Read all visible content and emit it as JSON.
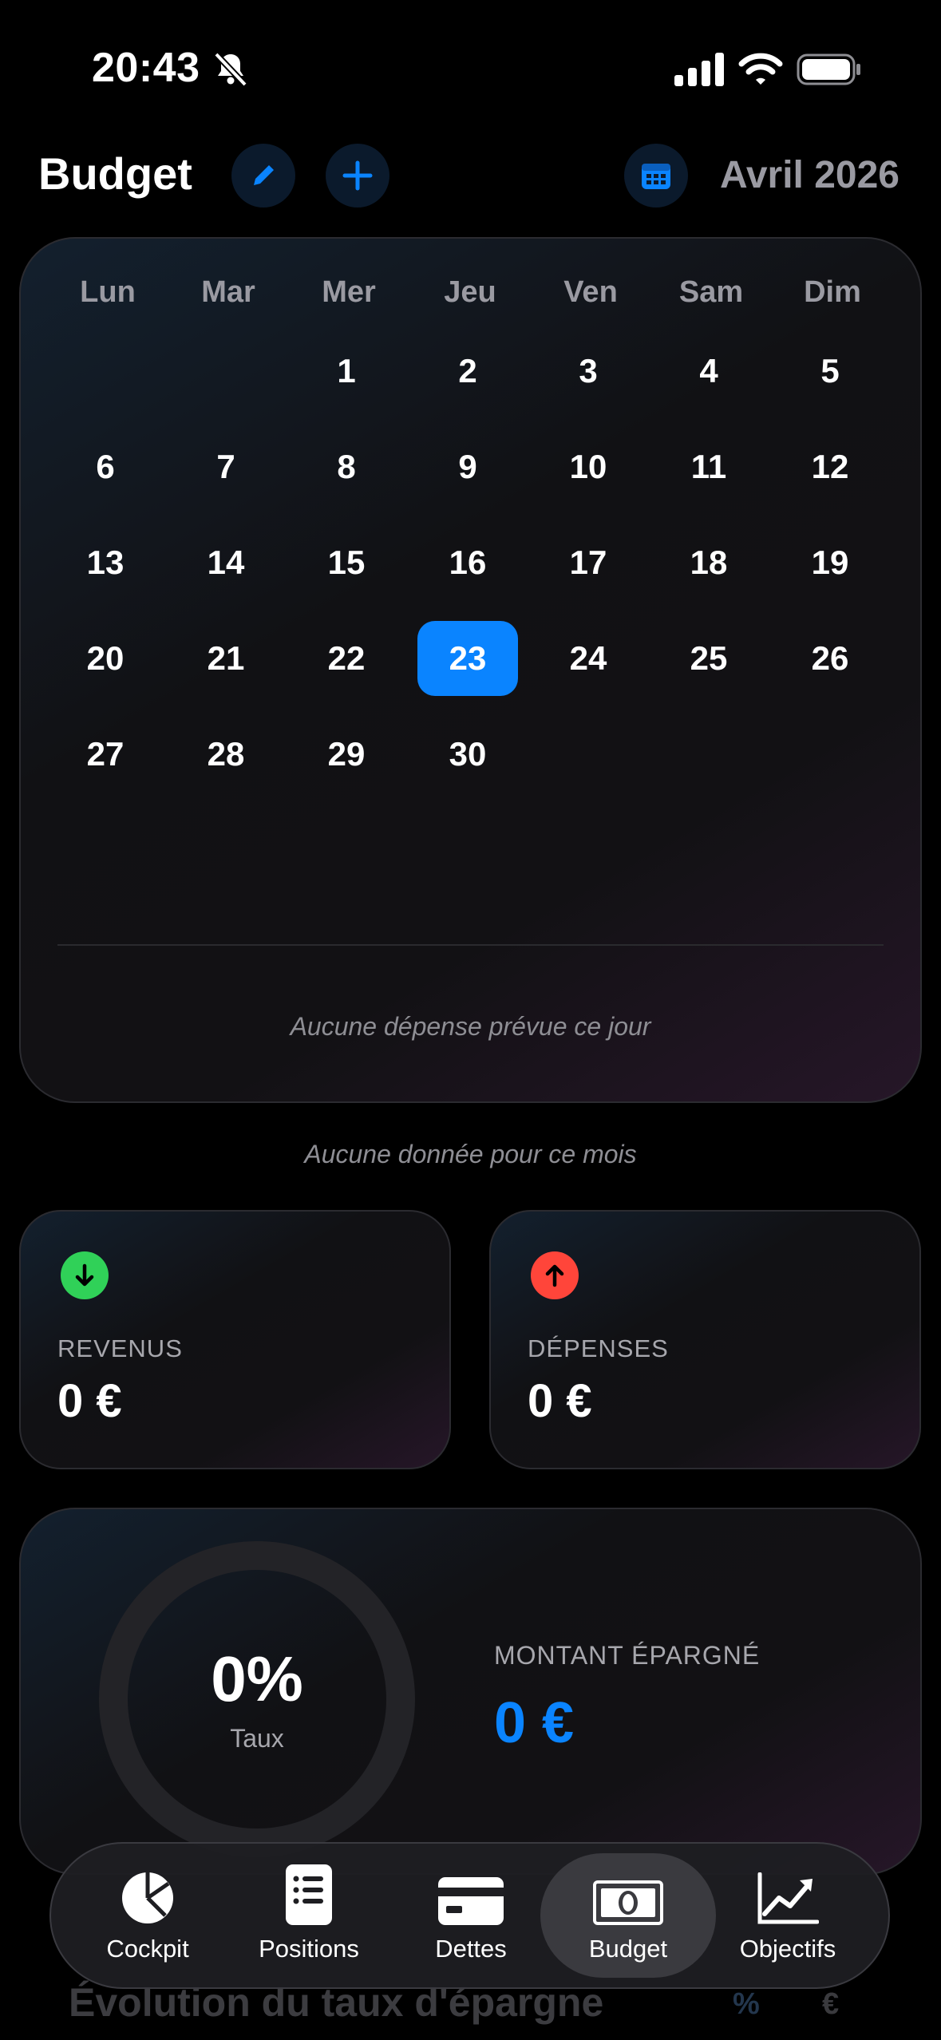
{
  "status": {
    "time": "20:43"
  },
  "header": {
    "title": "Budget",
    "month": "Avril 2026",
    "accent": "#0a84ff"
  },
  "calendar": {
    "weekdays": [
      "Lun",
      "Mar",
      "Mer",
      "Jeu",
      "Ven",
      "Sam",
      "Dim"
    ],
    "weeks": [
      [
        "",
        "",
        "1",
        "2",
        "3",
        "4",
        "5"
      ],
      [
        "6",
        "7",
        "8",
        "9",
        "10",
        "11",
        "12"
      ],
      [
        "13",
        "14",
        "15",
        "16",
        "17",
        "18",
        "19"
      ],
      [
        "20",
        "21",
        "22",
        "23",
        "24",
        "25",
        "26"
      ],
      [
        "27",
        "28",
        "29",
        "30",
        "",
        "",
        ""
      ]
    ],
    "selected_day": "23",
    "empty_day_note": "Aucune dépense prévue ce jour"
  },
  "month_note": "Aucune donnée pour ce mois",
  "revenus": {
    "label": "REVENUS",
    "value": "0 €",
    "color": "#30d158"
  },
  "depenses": {
    "label": "DÉPENSES",
    "value": "0 €",
    "color": "#ff453a"
  },
  "savings": {
    "rate": "0%",
    "rate_label": "Taux",
    "amount_label": "MONTANT ÉPARGNÉ",
    "amount": "0 €"
  },
  "next_section": {
    "title": "Évolution du taux d'épargne",
    "opt_pct": "%",
    "opt_eur": "€"
  },
  "tabs": [
    {
      "label": "Cockpit",
      "icon": "pie-chart-icon"
    },
    {
      "label": "Positions",
      "icon": "list-icon"
    },
    {
      "label": "Dettes",
      "icon": "credit-card-icon"
    },
    {
      "label": "Budget",
      "icon": "banknote-icon",
      "active": true
    },
    {
      "label": "Objectifs",
      "icon": "trend-chart-icon"
    }
  ]
}
